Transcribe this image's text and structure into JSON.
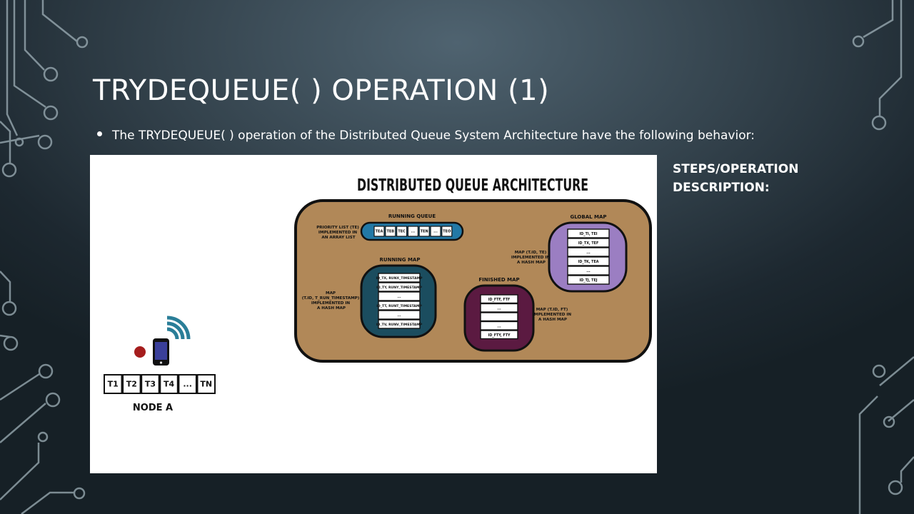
{
  "slide": {
    "title": "TRYDEQUEUE( ) OPERATION (1)",
    "bullet": "The TRYDEQUEUE( ) operation of the Distributed Queue System Architecture have the following behavior:",
    "side_heading_line1": "STEPS/OPERATION",
    "side_heading_line2": "DESCRIPTION:"
  },
  "diagram": {
    "title": "DISTRIBUTED QUEUE ARCHITECTURE",
    "running_queue": {
      "label": "RUNNING QUEUE",
      "note": [
        "PRIORITY LIST (TE)",
        "IMPLEMENTED IN",
        "AN ARRAY LIST"
      ],
      "cells": [
        "TEA",
        "TEB",
        "TEC",
        "...",
        "TEN",
        "...",
        "TEO"
      ]
    },
    "running_map": {
      "label": "RUNNING MAP",
      "note": [
        "MAP",
        "(T.ID, T_RUN_TIMESTAMP)",
        "IMPLEMENTED IN",
        "A HASH MAP"
      ],
      "rows": [
        "ID_TX, RUNX_TIMESTAMP",
        "ID_TY, RUNY_TIMESTAMP",
        "...",
        "ID_TT, RUNT_TIMESTAMP",
        "...",
        "ID_TV, RUNV_TIMESTAMP"
      ]
    },
    "finished_map": {
      "label": "FINISHED MAP",
      "note": [
        "MAP (T.ID, FT)",
        "IMPLEMENTED IN",
        "A HASH MAP"
      ],
      "rows": [
        "ID_FTF, FTF",
        "...",
        "",
        "...",
        "ID_FTY, FTY"
      ]
    },
    "global_map": {
      "label": "GLOBAL MAP",
      "note": [
        "MAP (T.ID, TE)",
        "IMPLEMENTED IN",
        "A HASH MAP"
      ],
      "rows": [
        "ID_TI, TEI",
        "ID_TX, TEF",
        "...",
        "ID_TK, TEA",
        "...",
        "ID_TJ, TEJ"
      ]
    },
    "node": {
      "label": "NODE A",
      "queue": [
        "T1",
        "T2",
        "T3",
        "T4",
        "...",
        "TN"
      ]
    },
    "colors": {
      "container": "#b18858",
      "running_queue": "#2379a6",
      "running_map": "#1b4d5f",
      "finished_map": "#5b1a41",
      "global_map": "#9b7ec2",
      "signal": "#2a7e98",
      "node_dot": "#a51d1d"
    }
  }
}
